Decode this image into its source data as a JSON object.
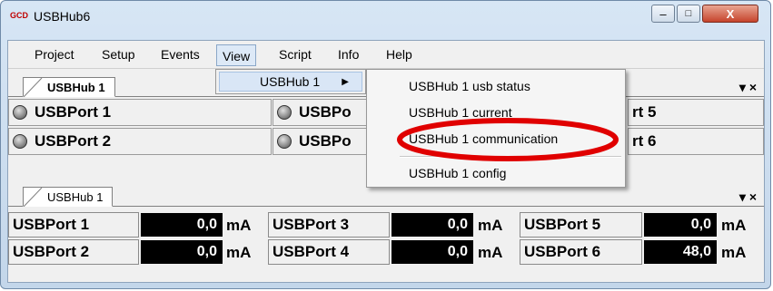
{
  "window": {
    "title": "USBHub6",
    "logo_text": "GCD"
  },
  "title_buttons": {
    "minimize": "–",
    "maximize": "□",
    "close": "X"
  },
  "menu": [
    {
      "label": "Project"
    },
    {
      "label": "Setup"
    },
    {
      "label": "Events"
    },
    {
      "label": "View"
    },
    {
      "label": "Script"
    },
    {
      "label": "Info"
    },
    {
      "label": "Help"
    }
  ],
  "view_submenu": {
    "label": "USBHub 1",
    "arrow": "▶"
  },
  "dropdown": {
    "items": [
      "USBHub 1 usb status",
      "USBHub 1 current",
      "USBHub 1 communication",
      "USBHub 1 config"
    ],
    "highlight_color": "#e00000"
  },
  "status_panel": {
    "tab": "USBHub 1",
    "close": "▾ ×",
    "ports": [
      "USBPort 1",
      "USBPort 2",
      "USBPo",
      "USBPo",
      "rt 5",
      "rt 6"
    ]
  },
  "current_panel": {
    "tab": "USBHub 1",
    "close": "▾ ×",
    "rows": [
      {
        "port": "USBPort 1",
        "value": "0,0",
        "unit": "mA"
      },
      {
        "port": "USBPort 2",
        "value": "0,0",
        "unit": "mA"
      },
      {
        "port": "USBPort 3",
        "value": "0,0",
        "unit": "mA"
      },
      {
        "port": "USBPort 4",
        "value": "0,0",
        "unit": "mA"
      },
      {
        "port": "USBPort 5",
        "value": "0,0",
        "unit": "mA"
      },
      {
        "port": "USBPort 6",
        "value": "48,0",
        "unit": "mA"
      }
    ]
  }
}
